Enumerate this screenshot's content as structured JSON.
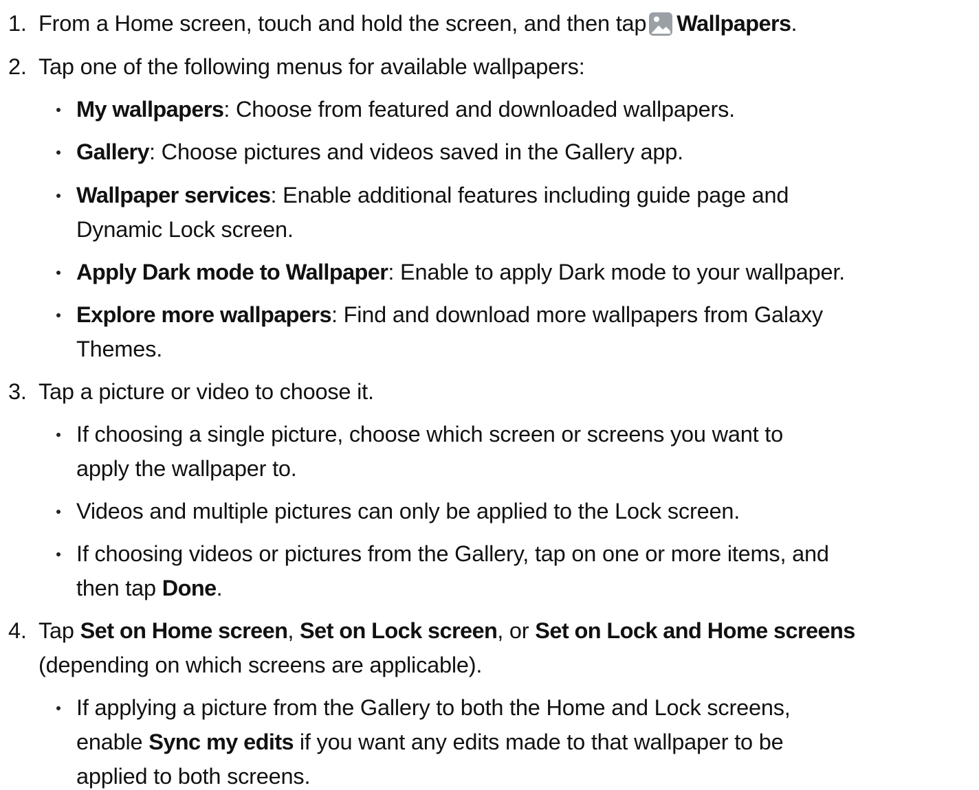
{
  "steps": [
    {
      "number": "1.",
      "text_before": "From a Home screen, touch and hold the screen, and then tap",
      "icon": "wallpapers-icon",
      "bold": "Wallpapers",
      "text_after": "."
    },
    {
      "number": "2.",
      "text": "Tap one of the following menus for available wallpapers:",
      "bullets": [
        {
          "bold": "My wallpapers",
          "text": ": Choose from featured and downloaded wallpapers."
        },
        {
          "bold": "Gallery",
          "text": ": Choose pictures and videos saved in the Gallery app."
        },
        {
          "bold": "Wallpaper services",
          "text": ": Enable additional features including guide page and",
          "text_line2": "Dynamic Lock screen."
        },
        {
          "bold": "Apply Dark mode to Wallpaper",
          "text": ": Enable to apply Dark mode to your wallpaper."
        },
        {
          "bold": "Explore more wallpapers",
          "text": ": Find and download more wallpapers from Galaxy",
          "text_line2": "Themes."
        }
      ]
    },
    {
      "number": "3.",
      "text": "Tap a picture or video to choose it.",
      "bullets": [
        {
          "text": "If choosing a single picture, choose which screen or screens you want to",
          "text_line2": "apply the wallpaper to."
        },
        {
          "text": "Videos and multiple pictures can only be applied to the Lock screen."
        },
        {
          "text": "If choosing videos or pictures from the Gallery, tap on one or more items, and",
          "text_line2_before": "then tap",
          "bold2": "Done",
          "text_line2_after": "."
        }
      ]
    },
    {
      "number": "4.",
      "text_before": "Tap",
      "bold_a": "Set on Home screen",
      "sep1": ",",
      "bold_b": "Set on Lock screen",
      "sep2": ", or",
      "bold_c": "Set on Lock and Home screens",
      "text_line2": "(depending on which screens are applicable).",
      "bullets": [
        {
          "text": "If applying a picture from the Gallery to both the Home and Lock screens,",
          "text_line2_before": "enable",
          "bold2": "Sync my edits",
          "text_line2_after": "if you want any edits made to that wallpaper to be",
          "text_line3": "applied to both screens."
        }
      ]
    }
  ],
  "colors": {
    "text": "#111111",
    "icon_background": "#9aa0a6"
  }
}
